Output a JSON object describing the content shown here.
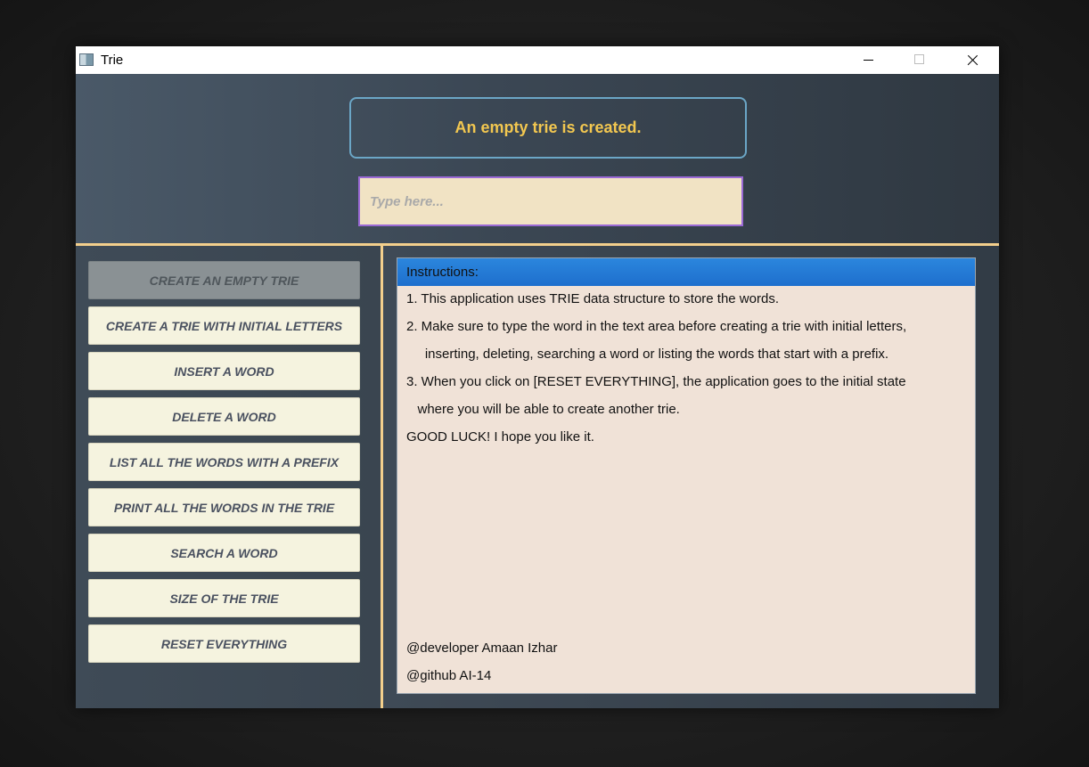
{
  "window": {
    "title": "Trie"
  },
  "status": {
    "message": "An empty trie is created."
  },
  "input": {
    "placeholder": "Type here...",
    "value": ""
  },
  "menu": {
    "items": [
      {
        "label": "CREATE AN EMPTY TRIE",
        "enabled": false
      },
      {
        "label": "CREATE A TRIE WITH INITIAL LETTERS",
        "enabled": true
      },
      {
        "label": "INSERT A WORD",
        "enabled": true
      },
      {
        "label": "DELETE A WORD",
        "enabled": true
      },
      {
        "label": "LIST ALL THE WORDS WITH A PREFIX",
        "enabled": true
      },
      {
        "label": "PRINT ALL THE WORDS IN THE TRIE",
        "enabled": true
      },
      {
        "label": "SEARCH A WORD",
        "enabled": true
      },
      {
        "label": "SIZE OF THE TRIE",
        "enabled": true
      },
      {
        "label": "RESET EVERYTHING",
        "enabled": true
      }
    ]
  },
  "instructions": {
    "header": "Instructions:",
    "lines": [
      "1. This application uses TRIE data structure to store the words.",
      "2. Make sure to type the word in the text area before creating a trie with initial letters,",
      "     inserting, deleting, searching a word or listing the words that start with a prefix.",
      "3. When you click on [RESET EVERYTHING], the application goes to the initial state",
      "   where you will be able to create another trie.",
      "GOOD LUCK! I hope you like it."
    ],
    "footer": [
      "@developer Amaan Izhar",
      "@github AI-14"
    ]
  },
  "colors": {
    "status_text": "#f2c750",
    "status_border": "#6ba6c6",
    "input_bg": "#f1e3c4",
    "input_border": "#9b6ad6",
    "divider": "#f3cf8c",
    "button_bg": "#f5f3df",
    "button_disabled_bg": "#8a9194",
    "instructions_header": "#1e6fcd",
    "instructions_bg": "#f0e2d7"
  }
}
